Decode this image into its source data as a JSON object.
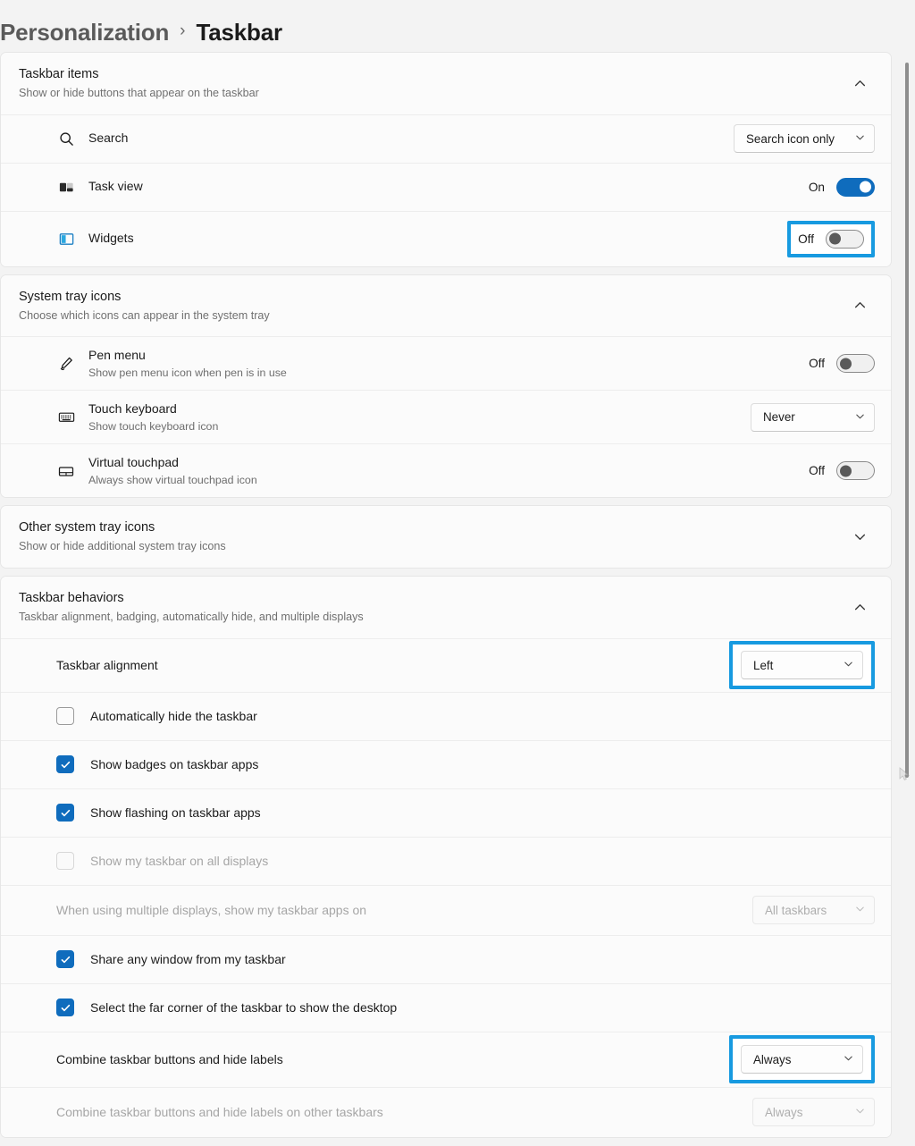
{
  "breadcrumb": {
    "parent": "Personalization",
    "separator": "›",
    "current": "Taskbar"
  },
  "colors": {
    "accent": "#0f6cbd",
    "highlight_box": "#179ae0",
    "page_bg": "#f3f3f3",
    "card_bg": "#fbfbfb",
    "text_primary": "#1b1b1b",
    "text_secondary": "#707070",
    "text_disabled": "#a6a6a6"
  },
  "sections": {
    "taskbar_items": {
      "title": "Taskbar items",
      "subtitle": "Show or hide buttons that appear on the taskbar",
      "expanded": true,
      "chevron": "chevron-up-icon",
      "rows": [
        {
          "icon": "search-icon",
          "title": "Search",
          "control": "combobox",
          "value": "Search icon only",
          "highlighted": false
        },
        {
          "icon": "task-view-icon",
          "title": "Task view",
          "control": "toggle",
          "state_label": "On",
          "state": "on",
          "highlighted": false
        },
        {
          "icon": "widgets-icon",
          "title": "Widgets",
          "control": "toggle",
          "state_label": "Off",
          "state": "off",
          "highlighted": true
        }
      ]
    },
    "system_tray_icons": {
      "title": "System tray icons",
      "subtitle": "Choose which icons can appear in the system tray",
      "expanded": true,
      "chevron": "chevron-up-icon",
      "rows": [
        {
          "icon": "pen-menu-icon",
          "title": "Pen menu",
          "desc": "Show pen menu icon when pen is in use",
          "control": "toggle",
          "state_label": "Off",
          "state": "off",
          "highlighted": false
        },
        {
          "icon": "touch-keyboard-icon",
          "title": "Touch keyboard",
          "desc": "Show touch keyboard icon",
          "control": "combobox",
          "value": "Never",
          "highlighted": false
        },
        {
          "icon": "virtual-touchpad-icon",
          "title": "Virtual touchpad",
          "desc": "Always show virtual touchpad icon",
          "control": "toggle",
          "state_label": "Off",
          "state": "off",
          "highlighted": false
        }
      ]
    },
    "other_system_tray_icons": {
      "title": "Other system tray icons",
      "subtitle": "Show or hide additional system tray icons",
      "expanded": false,
      "chevron": "chevron-down-icon"
    },
    "taskbar_behaviors": {
      "title": "Taskbar behaviors",
      "subtitle": "Taskbar alignment, badging, automatically hide, and multiple displays",
      "expanded": true,
      "chevron": "chevron-up-icon",
      "rows": [
        {
          "kind": "combo",
          "label": "Taskbar alignment",
          "value": "Left",
          "disabled": false,
          "highlighted": true
        },
        {
          "kind": "checkbox",
          "label": "Automatically hide the taskbar",
          "checked": false,
          "disabled": false
        },
        {
          "kind": "checkbox",
          "label": "Show badges on taskbar apps",
          "checked": true,
          "disabled": false
        },
        {
          "kind": "checkbox",
          "label": "Show flashing on taskbar apps",
          "checked": true,
          "disabled": false
        },
        {
          "kind": "checkbox",
          "label": "Show my taskbar on all displays",
          "checked": false,
          "disabled": true
        },
        {
          "kind": "combo",
          "label": "When using multiple displays, show my taskbar apps on",
          "value": "All taskbars",
          "disabled": true,
          "highlighted": false
        },
        {
          "kind": "checkbox",
          "label": "Share any window from my taskbar",
          "checked": true,
          "disabled": false
        },
        {
          "kind": "checkbox",
          "label": "Select the far corner of the taskbar to show the desktop",
          "checked": true,
          "disabled": false
        },
        {
          "kind": "combo",
          "label": "Combine taskbar buttons and hide labels",
          "value": "Always",
          "disabled": false,
          "highlighted": true
        },
        {
          "kind": "combo",
          "label": "Combine taskbar buttons and hide labels on other taskbars",
          "value": "Always",
          "disabled": true,
          "highlighted": false
        }
      ]
    }
  },
  "scrollbar": {
    "name": "vertical-scrollbar"
  }
}
